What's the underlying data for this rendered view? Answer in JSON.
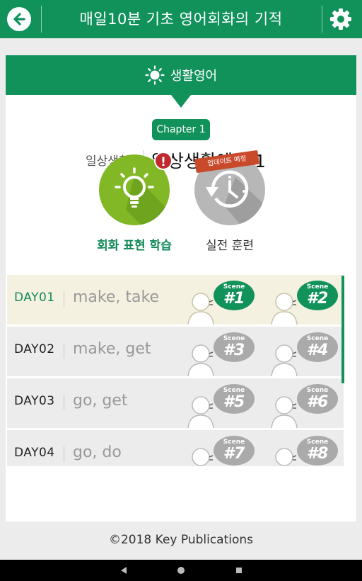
{
  "app": {
    "title": "매일10분 기초 영어회화의 기적"
  },
  "section": {
    "title": "생활영어"
  },
  "chapter": {
    "badge": "Chapter 1",
    "category": "일상생활",
    "title": "일상생활에서 1"
  },
  "modes": [
    {
      "label": "회화 표현 학습",
      "alert": "!"
    },
    {
      "label": "실전 훈련",
      "ribbon": "업데이트 예정"
    }
  ],
  "days": [
    {
      "day": "DAY01",
      "words": "make, take",
      "scenes": [
        "#1",
        "#2"
      ],
      "scene_label": "Scene",
      "active": true
    },
    {
      "day": "DAY02",
      "words": "make, get",
      "scenes": [
        "#3",
        "#4"
      ],
      "scene_label": "Scene",
      "active": false
    },
    {
      "day": "DAY03",
      "words": "go, get",
      "scenes": [
        "#5",
        "#6"
      ],
      "scene_label": "Scene",
      "active": false
    },
    {
      "day": "DAY04",
      "words": "go, do",
      "scenes": [
        "#7",
        "#8"
      ],
      "scene_label": "Scene",
      "active": false
    }
  ],
  "footer": {
    "copyright": "©2018 Key Publications"
  },
  "colors": {
    "primary": "#11925b",
    "lime": "#82b826",
    "alert": "#c0292f",
    "inactive_scene": "#aaaaaa"
  },
  "icons": {
    "back": "back-arrow-icon",
    "settings": "gear-icon",
    "section": "sun-icon",
    "learn": "lightbulb-icon",
    "practice": "clock-refresh-icon"
  }
}
